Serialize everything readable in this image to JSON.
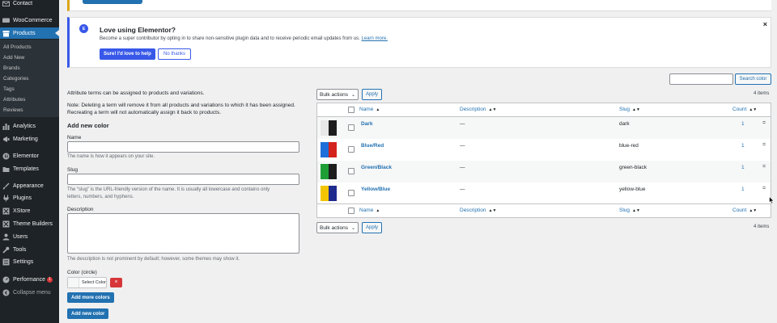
{
  "sidebar": {
    "items": [
      {
        "key": "contact",
        "label": "Contact"
      },
      {
        "key": "woocommerce",
        "label": "WooCommerce"
      },
      {
        "key": "products",
        "label": "Products"
      },
      {
        "key": "analytics",
        "label": "Analytics"
      },
      {
        "key": "marketing",
        "label": "Marketing"
      },
      {
        "key": "elementor",
        "label": "Elementor"
      },
      {
        "key": "templates",
        "label": "Templates"
      },
      {
        "key": "appearance",
        "label": "Appearance"
      },
      {
        "key": "plugins",
        "label": "Plugins"
      },
      {
        "key": "xstore",
        "label": "XStore"
      },
      {
        "key": "theme-builders",
        "label": "Theme Builders"
      },
      {
        "key": "users",
        "label": "Users"
      },
      {
        "key": "tools",
        "label": "Tools"
      },
      {
        "key": "settings",
        "label": "Settings"
      },
      {
        "key": "performance",
        "label": "Performance",
        "badge": "1"
      },
      {
        "key": "collapse",
        "label": "Collapse menu"
      }
    ],
    "products_submenu": [
      "All Products",
      "Add New",
      "Brands",
      "Categories",
      "Tags",
      "Attributes",
      "Reviews"
    ]
  },
  "notice": {
    "logo_text": "E",
    "title": "Love using Elementor?",
    "text": "Become a super contributor by opting in to share non-sensitive plugin data and to receive periodic email updates from us.",
    "link": "Learn more.",
    "yes_button": "Sure! I'd love to help",
    "no_button": "No thanks",
    "close": "×"
  },
  "form": {
    "intro": "Attribute terms can be assigned to products and variations.",
    "note_line1": "Note: Deleting a term will remove it from all products and variations to which it has been assigned.",
    "note_line2": "Recreating a term will not automatically assign it back to products.",
    "heading": "Add new color",
    "name_label": "Name",
    "name_help": "The name is how it appears on your site.",
    "slug_label": "Slug",
    "slug_help_line1": "The “slug” is the URL-friendly version of the name. It is usually all lowercase and contains only",
    "slug_help_line2": "letters, numbers, and hyphens.",
    "description_label": "Description",
    "description_help": "The description is not prominent by default; however, some themes may show it.",
    "color_label": "Color (circle)",
    "select_color": "Select Color",
    "remove_color": "×",
    "add_more_colors": "Add more colors",
    "add_new_color": "Add new color"
  },
  "table": {
    "search_button": "Search color",
    "bulk_actions": "Bulk actions",
    "apply": "Apply",
    "items_count": "4 items",
    "columns": {
      "name": "Name",
      "description": "Description",
      "slug": "Slug",
      "count": "Count"
    },
    "sort_icon": "▲▼",
    "rows": [
      {
        "name": "Dark",
        "description": "—",
        "slug": "dark",
        "count": "1",
        "colors": [
          "#e8e8e8",
          "#1d1d1d"
        ]
      },
      {
        "name": "Blue/Red",
        "description": "—",
        "slug": "blue-red",
        "count": "1",
        "colors": [
          "#1e6fd9",
          "#d4221c"
        ]
      },
      {
        "name": "Green/Black",
        "description": "—",
        "slug": "green-black",
        "count": "1",
        "colors": [
          "#1f9e36",
          "#1d1d1d"
        ]
      },
      {
        "name": "Yellow/Blue",
        "description": "—",
        "slug": "yellow-blue",
        "count": "1",
        "colors": [
          "#f2c500",
          "#1f2a8f"
        ]
      }
    ],
    "drag_icon": "="
  }
}
